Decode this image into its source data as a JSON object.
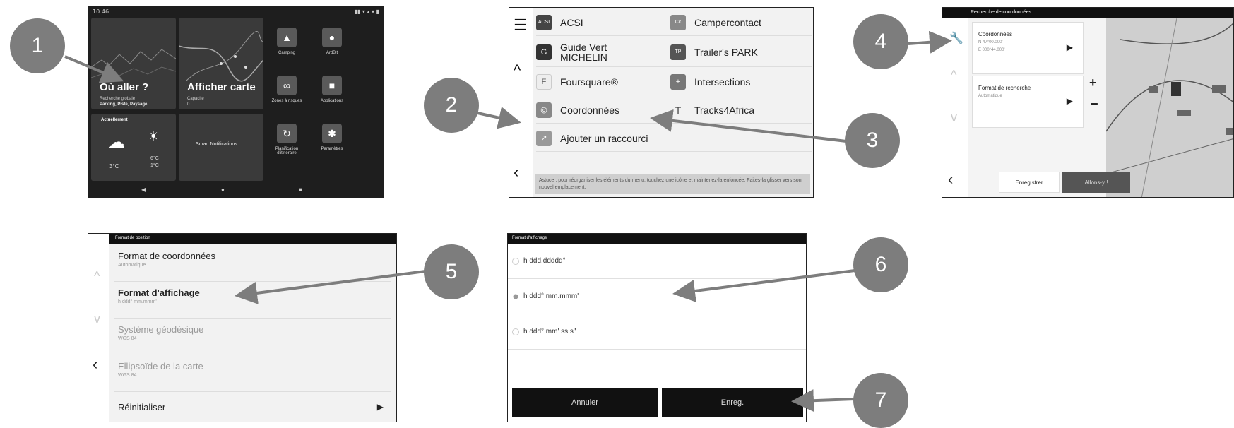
{
  "callouts": [
    "1",
    "2",
    "3",
    "4",
    "5",
    "6",
    "7"
  ],
  "screen1": {
    "status_time": "10:46",
    "status_right": "▮▮ ▾ ▴ ▾ ▮",
    "where_title": "Où aller ?",
    "where_sub1": "Recherche globale",
    "where_sub2": "Parking, Piste, Paysage",
    "map_title": "Afficher carte",
    "map_sub1": "Capacité",
    "map_sub2": "0",
    "weather_label": "Actuellement",
    "weather_temp1": "3°C",
    "weather_temp2": "6°C",
    "weather_temp3": "1°C",
    "notif_label": "Smart Notifications",
    "apps": [
      {
        "label": "Camping",
        "glyph": "▲"
      },
      {
        "label": "ArdBit",
        "glyph": "●"
      },
      {
        "label": "Zones à risques",
        "glyph": "∞"
      },
      {
        "label": "Applications",
        "glyph": "■"
      },
      {
        "label": "Planification d'itinéraire",
        "glyph": "↻"
      },
      {
        "label": "Paramètres",
        "glyph": "✱"
      }
    ],
    "nav": [
      "◀",
      "●",
      "■"
    ]
  },
  "screen2": {
    "items": [
      {
        "label": "ACSI",
        "icon": "ACSI"
      },
      {
        "label": "Campercontact",
        "icon": "Cc"
      },
      {
        "label": "Guide Vert\nMICHELIN",
        "icon": "G"
      },
      {
        "label": "Trailer's PARK",
        "icon": "TP"
      },
      {
        "label": "Foursquare®",
        "icon": "F"
      },
      {
        "label": "Intersections",
        "icon": "+"
      },
      {
        "label": "Coordonnées",
        "icon": "◎"
      },
      {
        "label": "Tracks4Africa",
        "icon": "T"
      },
      {
        "label": "Ajouter un raccourci",
        "icon": "↗"
      }
    ],
    "hint": "Astuce : pour réorganiser les éléments du menu, touchez une icône et maintenez-la enfoncée. Faites-la glisser vers son nouvel emplacement."
  },
  "screen3": {
    "title": "Recherche de coordonnées",
    "coords_label": "Coordonnées",
    "coords_v1": "N 47°00.000'",
    "coords_v2": "E 000°44.000'",
    "format_label": "Format de recherche",
    "format_value": "Automatique",
    "save": "Enregistrer",
    "go": "Allons-y !"
  },
  "screen4": {
    "title": "Format de position",
    "items": [
      {
        "label": "Format de coordonnées",
        "value": "Automatique"
      },
      {
        "label": "Format d'affichage",
        "value": "h ddd° mm.mmm'"
      },
      {
        "label": "Système géodésique",
        "value": "WGS 84"
      },
      {
        "label": "Ellipsoïde de la carte",
        "value": "WGS 84"
      },
      {
        "label": "Réinitialiser",
        "value": ""
      }
    ]
  },
  "screen5": {
    "title": "Format d'affichage",
    "options": [
      {
        "label": "h ddd.ddddd°",
        "selected": false
      },
      {
        "label": "h ddd° mm.mmm'",
        "selected": true
      },
      {
        "label": "h ddd° mm' ss.s\"",
        "selected": false
      }
    ],
    "cancel": "Annuler",
    "save": "Enreg."
  }
}
